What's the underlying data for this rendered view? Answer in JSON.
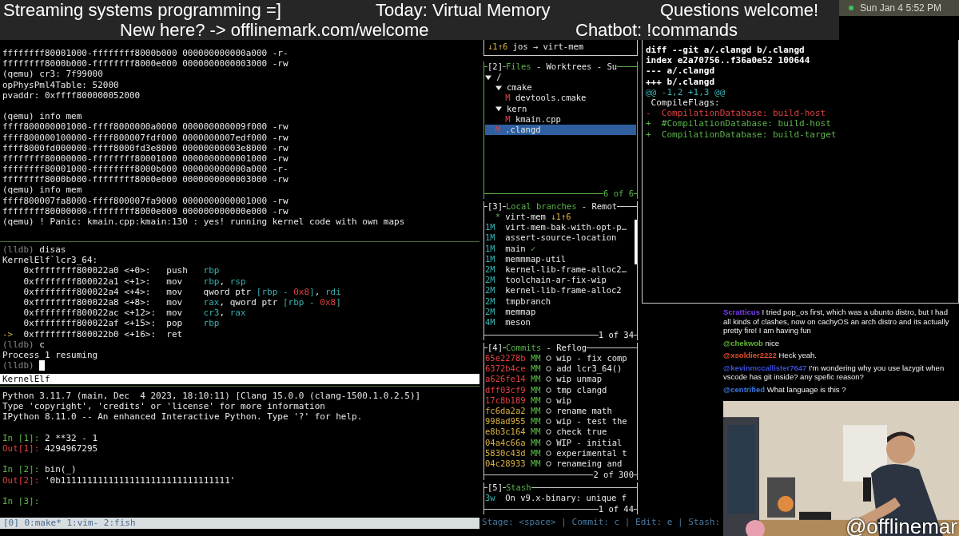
{
  "overlay": {
    "row_1": [
      "Streaming systems programming =]",
      "Today: Virtual Memory",
      "Questions welcome!"
    ],
    "row_2": [
      "New here? -> offlinemark.com/welcome",
      "Chatbot: !commands"
    ]
  },
  "menubar": {
    "clock": "Sun Jan 4  5:52 PM"
  },
  "qemu": {
    "lines": [
      {
        "text": "ffffffff80001000-ffffffff8000b000 000000000000a000 -r-"
      },
      {
        "text": "ffffffff8000b000-ffffffff8000e000 0000000000003000 -rw"
      },
      {
        "text": "(qemu) cr3: 7f99000"
      },
      {
        "text": "opPhysPml4Table: 52000"
      },
      {
        "text": "pvaddr: 0xffff800000052000"
      },
      {
        "kind": "blank"
      },
      {
        "text": "(qemu) info mem"
      },
      {
        "text": "ffff800000001000-ffff8000000a0000 000000000009f000 -rw"
      },
      {
        "text": "ffff800000100000-ffff800007fdf000 0000000007edf000 -rw"
      },
      {
        "text": "ffff8000fd000000-ffff8000fd3e8000 00000000003e8000 -rw"
      },
      {
        "text": "ffffffff80000000-ffffffff80001000 0000000000001000 -rw"
      },
      {
        "text": "ffffffff80001000-ffffffff8000b000 000000000000a000 -r-"
      },
      {
        "text": "ffffffff8000b000-ffffffff8000e000 0000000000003000 -rw"
      },
      {
        "text": "(qemu) info mem"
      },
      {
        "text": "ffff800007fa8000-ffff800007fa9000 0000000000001000 -rw"
      },
      {
        "text": "ffffffff80000000-ffffffff8000e000 000000000000e000 -rw"
      },
      {
        "text": "(qemu) ! Panic: kmain.cpp:kmain:130 : yes! running kernel code with own maps"
      }
    ]
  },
  "lldb": {
    "lines": [
      {
        "kind": "prompt",
        "prompt": "(lldb)",
        "text": "disas"
      },
      {
        "kind": "text",
        "text": "KernelElf`lcr3_64:"
      },
      {
        "kind": "asm",
        "address": "0xffffffff800022a0",
        "offset": "<+0>:",
        "op": "push",
        "args": [
          {
            "kind": "reg",
            "t": "rbp"
          }
        ]
      },
      {
        "kind": "asm",
        "address": "0xffffffff800022a1",
        "offset": "<+1>:",
        "op": "mov",
        "args": [
          {
            "kind": "reg",
            "t": "rbp"
          },
          {
            "kind": "plain",
            "t": ", "
          },
          {
            "kind": "reg",
            "t": "rsp"
          }
        ]
      },
      {
        "kind": "asm",
        "address": "0xffffffff800022a4",
        "offset": "<+4>:",
        "op": "mov",
        "args": [
          {
            "kind": "plain",
            "t": "qword ptr "
          },
          {
            "kind": "reg",
            "t": "[rbp - "
          },
          {
            "kind": "num",
            "t": "0x8"
          },
          {
            "kind": "reg",
            "t": "]"
          },
          {
            "kind": "plain",
            "t": ", "
          },
          {
            "kind": "reg",
            "t": "rdi"
          }
        ]
      },
      {
        "kind": "asm",
        "address": "0xffffffff800022a8",
        "offset": "<+8>:",
        "op": "mov",
        "args": [
          {
            "kind": "reg",
            "t": "rax"
          },
          {
            "kind": "plain",
            "t": ", qword ptr "
          },
          {
            "kind": "reg",
            "t": "[rbp - "
          },
          {
            "kind": "num",
            "t": "0x8"
          },
          {
            "kind": "reg",
            "t": "]"
          }
        ]
      },
      {
        "kind": "asm",
        "address": "0xffffffff800022ac",
        "offset": "<+12>:",
        "op": "mov",
        "args": [
          {
            "kind": "reg",
            "t": "cr3"
          },
          {
            "kind": "plain",
            "t": ", "
          },
          {
            "kind": "reg",
            "t": "rax"
          }
        ]
      },
      {
        "kind": "asm",
        "address": "0xffffffff800022af",
        "offset": "<+15>:",
        "op": "pop",
        "args": [
          {
            "kind": "reg",
            "t": "rbp"
          }
        ]
      },
      {
        "kind": "asm",
        "marker": "->",
        "address": "0xffffffff800022b0",
        "offset": "<+16>:",
        "op": "ret"
      },
      {
        "kind": "prompt",
        "prompt": "(lldb)",
        "text": "c"
      },
      {
        "kind": "text",
        "text": "Process 1 resuming"
      },
      {
        "kind": "prompt",
        "prompt": "(lldb)",
        "cursor": true
      }
    ],
    "status": "KernelElf"
  },
  "python": {
    "lines": [
      {
        "kind": "text",
        "text": "Python 3.11.7 (main, Dec  4 2023, 18:10:11) [Clang 15.0.0 (clang-1500.1.0.2.5)]"
      },
      {
        "kind": "text",
        "text": "Type 'copyright', 'credits' or 'license' for more information"
      },
      {
        "kind": "text",
        "text": "IPython 8.11.0 -- An enhanced Interactive Python. Type '?' for help."
      },
      {
        "kind": "blank"
      },
      {
        "kind": "in",
        "prompt": "In [1]:",
        "text": "2 **32 - 1"
      },
      {
        "kind": "out",
        "prompt": "Out[1]:",
        "text": "4294967295"
      },
      {
        "kind": "blank"
      },
      {
        "kind": "in",
        "prompt": "In [2]:",
        "text": "bin(_)"
      },
      {
        "kind": "out",
        "prompt": "Out[2]:",
        "text": "'0b11111111111111111111111111111111'"
      },
      {
        "kind": "blank"
      },
      {
        "kind": "in",
        "prompt": "In [3]:"
      }
    ]
  },
  "tmux": {
    "status": "[0] 0:make* 1:vim- 2:fish"
  },
  "lazygit": {
    "status": {
      "sync": "↓1↑6",
      "repo": "jos → virt-mem"
    },
    "files": {
      "number": "[2]",
      "focused": true,
      "separator": "-",
      "tabs": [
        {
          "label": "Files",
          "selected": true
        },
        {
          "label": "Worktrees",
          "selected": false
        },
        {
          "label": "Su",
          "selected": false
        }
      ],
      "footer": "6 of 6",
      "tree": [
        {
          "name": "/",
          "expanded": true,
          "selected": false,
          "children": [
            {
              "name": "cmake",
              "expanded": true,
              "selected": false,
              "children": [
                {
                  "name": "devtools.cmake",
                  "status": "M",
                  "selected": false
                }
              ]
            },
            {
              "name": "kern",
              "expanded": true,
              "selected": false,
              "children": [
                {
                  "name": "kmain.cpp",
                  "status": "M",
                  "selected": false
                }
              ]
            },
            {
              "name": ".clangd",
              "status": "M",
              "selected": true
            }
          ]
        }
      ]
    },
    "branches": {
      "number": "[3]",
      "focused": false,
      "separator": "-",
      "tabs": [
        {
          "label": "Local branches",
          "selected": true
        },
        {
          "label": "Remot",
          "selected": false
        }
      ],
      "footer": "1 of 34",
      "rows": [
        {
          "marker": "*",
          "name": "virt-mem",
          "suffix": "↓1↑6",
          "kind": "current"
        },
        {
          "age": "1M",
          "name": "virt-mem-bak-with-opt-p…"
        },
        {
          "age": "1M",
          "name": "assert-source-location"
        },
        {
          "age": "1M",
          "name": "main",
          "suffix": "✓",
          "kind": "merged"
        },
        {
          "age": "1M",
          "name": "memmmap-util"
        },
        {
          "age": "2M",
          "name": "kernel-lib-frame-alloc2…"
        },
        {
          "age": "2M",
          "name": "toolchain-ar-fix-wip"
        },
        {
          "age": "2M",
          "name": "kernel-lib-frame-alloc2"
        },
        {
          "age": "2M",
          "name": "tmpbranch"
        },
        {
          "age": "2M",
          "name": "memmap"
        },
        {
          "age": "4M",
          "name": "meson"
        }
      ]
    },
    "commits": {
      "number": "[4]",
      "focused": false,
      "separator": "-",
      "tabs": [
        {
          "label": "Commits",
          "selected": true
        },
        {
          "label": "Reflog",
          "selected": false
        }
      ],
      "footer": "2 of 300",
      "rows": [
        {
          "hash": "65e2278b",
          "pushed": false,
          "status": "MM",
          "message": "wip - fix comp"
        },
        {
          "hash": "6372b4ce",
          "pushed": false,
          "status": "MM",
          "message": "add lcr3_64()"
        },
        {
          "hash": "a626fe14",
          "pushed": false,
          "status": "MM",
          "message": "wip unmap"
        },
        {
          "hash": "dff03cf9",
          "pushed": false,
          "status": "MM",
          "message": "tmp clangd"
        },
        {
          "hash": "17c8b189",
          "pushed": false,
          "status": "MM",
          "message": "wip"
        },
        {
          "hash": "fc6da2a2",
          "pushed": true,
          "status": "MM",
          "message": "rename math"
        },
        {
          "hash": "998ad955",
          "pushed": true,
          "status": "MM",
          "message": "wip - test the"
        },
        {
          "hash": "e8b3c164",
          "pushed": true,
          "status": "MM",
          "message": "check true"
        },
        {
          "hash": "04a4c66a",
          "pushed": true,
          "status": "MM",
          "message": "WIP - initial"
        },
        {
          "hash": "5830c43d",
          "pushed": true,
          "status": "MM",
          "message": "experimental t"
        },
        {
          "hash": "04c28933",
          "pushed": true,
          "status": "MM",
          "message": "renameing and"
        }
      ]
    },
    "stash": {
      "number": "[5]",
      "focused": false,
      "tabs": [
        {
          "label": "Stash",
          "selected": true
        }
      ],
      "footer": "1 of 44",
      "rows": [
        {
          "age": "3w",
          "message": "On v9.x-binary: unique f"
        }
      ]
    },
    "keybindings": "Stage: <space> | Commit: c | Edit: e | Stash:"
  },
  "diff": {
    "lines": [
      {
        "kind": "header",
        "text": "diff --git a/.clangd b/.clangd"
      },
      {
        "kind": "header",
        "text": "index e2a70756..f36a0e52 100644"
      },
      {
        "kind": "header",
        "text": "--- a/.clangd"
      },
      {
        "kind": "header",
        "text": "+++ b/.clangd"
      },
      {
        "kind": "hunk",
        "text": "@@ -1,2 +1,3 @@"
      },
      {
        "kind": "context",
        "text": " CompileFlags:"
      },
      {
        "kind": "del",
        "text": "-  CompilationDatabase: build-host"
      },
      {
        "kind": "add",
        "text": "+  #CompilationDatabase: build-host"
      },
      {
        "kind": "add",
        "text": "+  CompilationDatabase: build-target"
      }
    ]
  },
  "chat": {
    "messages": [
      {
        "user": "Scratticus",
        "color": "#7a3cf0",
        "text": "I tried pop_os first, which was a ubunto distro, but I had all kinds of clashes, now on cachyOS an arch distro and its actually pretty fire! I am having fun"
      },
      {
        "user": "@chekwob",
        "color": "#5fb530",
        "text": "nice"
      },
      {
        "user": "@xsoldier2222",
        "color": "#e0502a",
        "text": "Heck yeah."
      },
      {
        "user": "@kevinmccallister7647",
        "color": "#3a4fd8",
        "text": "I'm wondering why you use lazygit when vscode has git inside? any spefic reason?"
      },
      {
        "user": "@centrified",
        "color": "#3a78e0",
        "text": "What language is this ?"
      }
    ]
  },
  "webcam": {
    "kind": "picture",
    "handle": "@offlinemar"
  }
}
